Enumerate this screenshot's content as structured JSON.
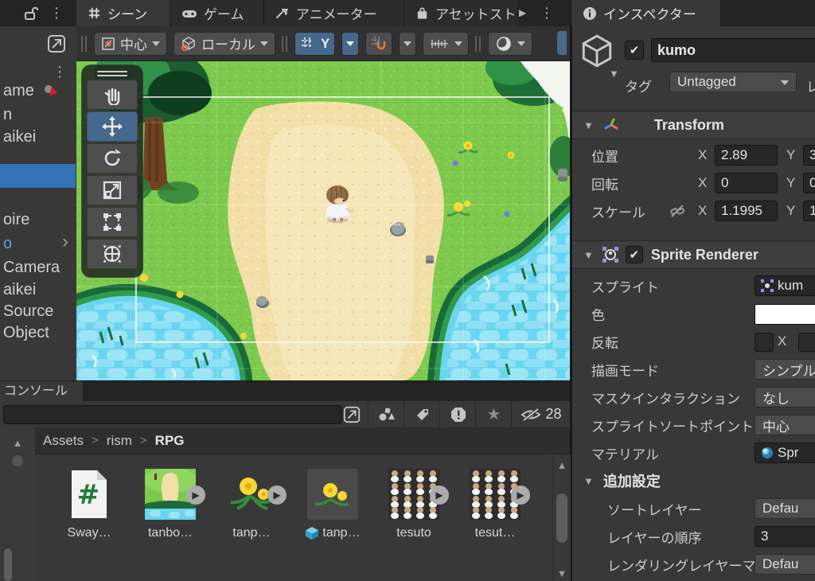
{
  "theme": {
    "accent": "#46688c",
    "selection": "#3573b8",
    "prefab": "#5c9ce6",
    "grass": "#7dc94d",
    "sand": "#f2dfa8",
    "water": "#69d6ef",
    "cliff": "#186b39"
  },
  "top_bar": {
    "menu_glyph": "⋮",
    "tabs": {
      "scene": "シーン",
      "game": "ゲーム",
      "animator": "アニメーター",
      "asset_store": "アセットスト",
      "inspector": "インスペクター"
    },
    "overflow_glyph": "▶"
  },
  "scene_toolbar": {
    "pivot_label": "中心",
    "orientation_label": "ローカル",
    "grid_axis": "Y"
  },
  "hierarchy": {
    "items": [
      "ame",
      "n",
      "aikei",
      "",
      "oire",
      "o",
      "Camera",
      "aikei",
      "Source",
      "Object"
    ],
    "chevron": "›"
  },
  "inspector": {
    "name": "kumo",
    "check_glyph": "✔",
    "tag_label": "タグ",
    "tag_value": "Untagged",
    "layer_label_partial": "レ",
    "transform": {
      "title": "Transform",
      "axis_x": "X",
      "axis_y": "Y",
      "position": {
        "label": "位置",
        "x": "2.89",
        "y": "3"
      },
      "rotation": {
        "label": "回転",
        "x": "0",
        "y": "0"
      },
      "scale": {
        "label": "スケール",
        "x": "1.1995",
        "y": "1"
      }
    },
    "sprite_renderer": {
      "title": "Sprite Renderer",
      "sprite_label": "スプライト",
      "sprite_value": "kum",
      "color_label": "色",
      "flip_label": "反転",
      "flip_x": "X",
      "draw_mode_label": "描画モード",
      "draw_mode_value": "シンプル",
      "mask_label": "マスクインタラクション",
      "mask_value": "なし",
      "sort_point_label": "スプライトソートポイント",
      "sort_point_value": "中心",
      "material_label": "マテリアル",
      "material_value": "Spr"
    },
    "additional": {
      "title": "追加設定",
      "sorting_layer_label": "ソートレイヤー",
      "sorting_layer_value": "Defau",
      "order_label": "レイヤーの順序",
      "order_value": "3",
      "rendering_layer_label": "レンダリングレイヤーマ",
      "rendering_layer_value": "Defau"
    }
  },
  "console": {
    "tab_label": "コンソール",
    "hidden_count": "28"
  },
  "project": {
    "breadcrumb": [
      "Assets",
      "rism",
      "RPG"
    ],
    "separator": ">",
    "assets": [
      "Sway…",
      "tanbo…",
      "tanp…",
      "tanp…",
      "tesuto",
      "tesut…"
    ],
    "expand_glyph": "▶"
  }
}
